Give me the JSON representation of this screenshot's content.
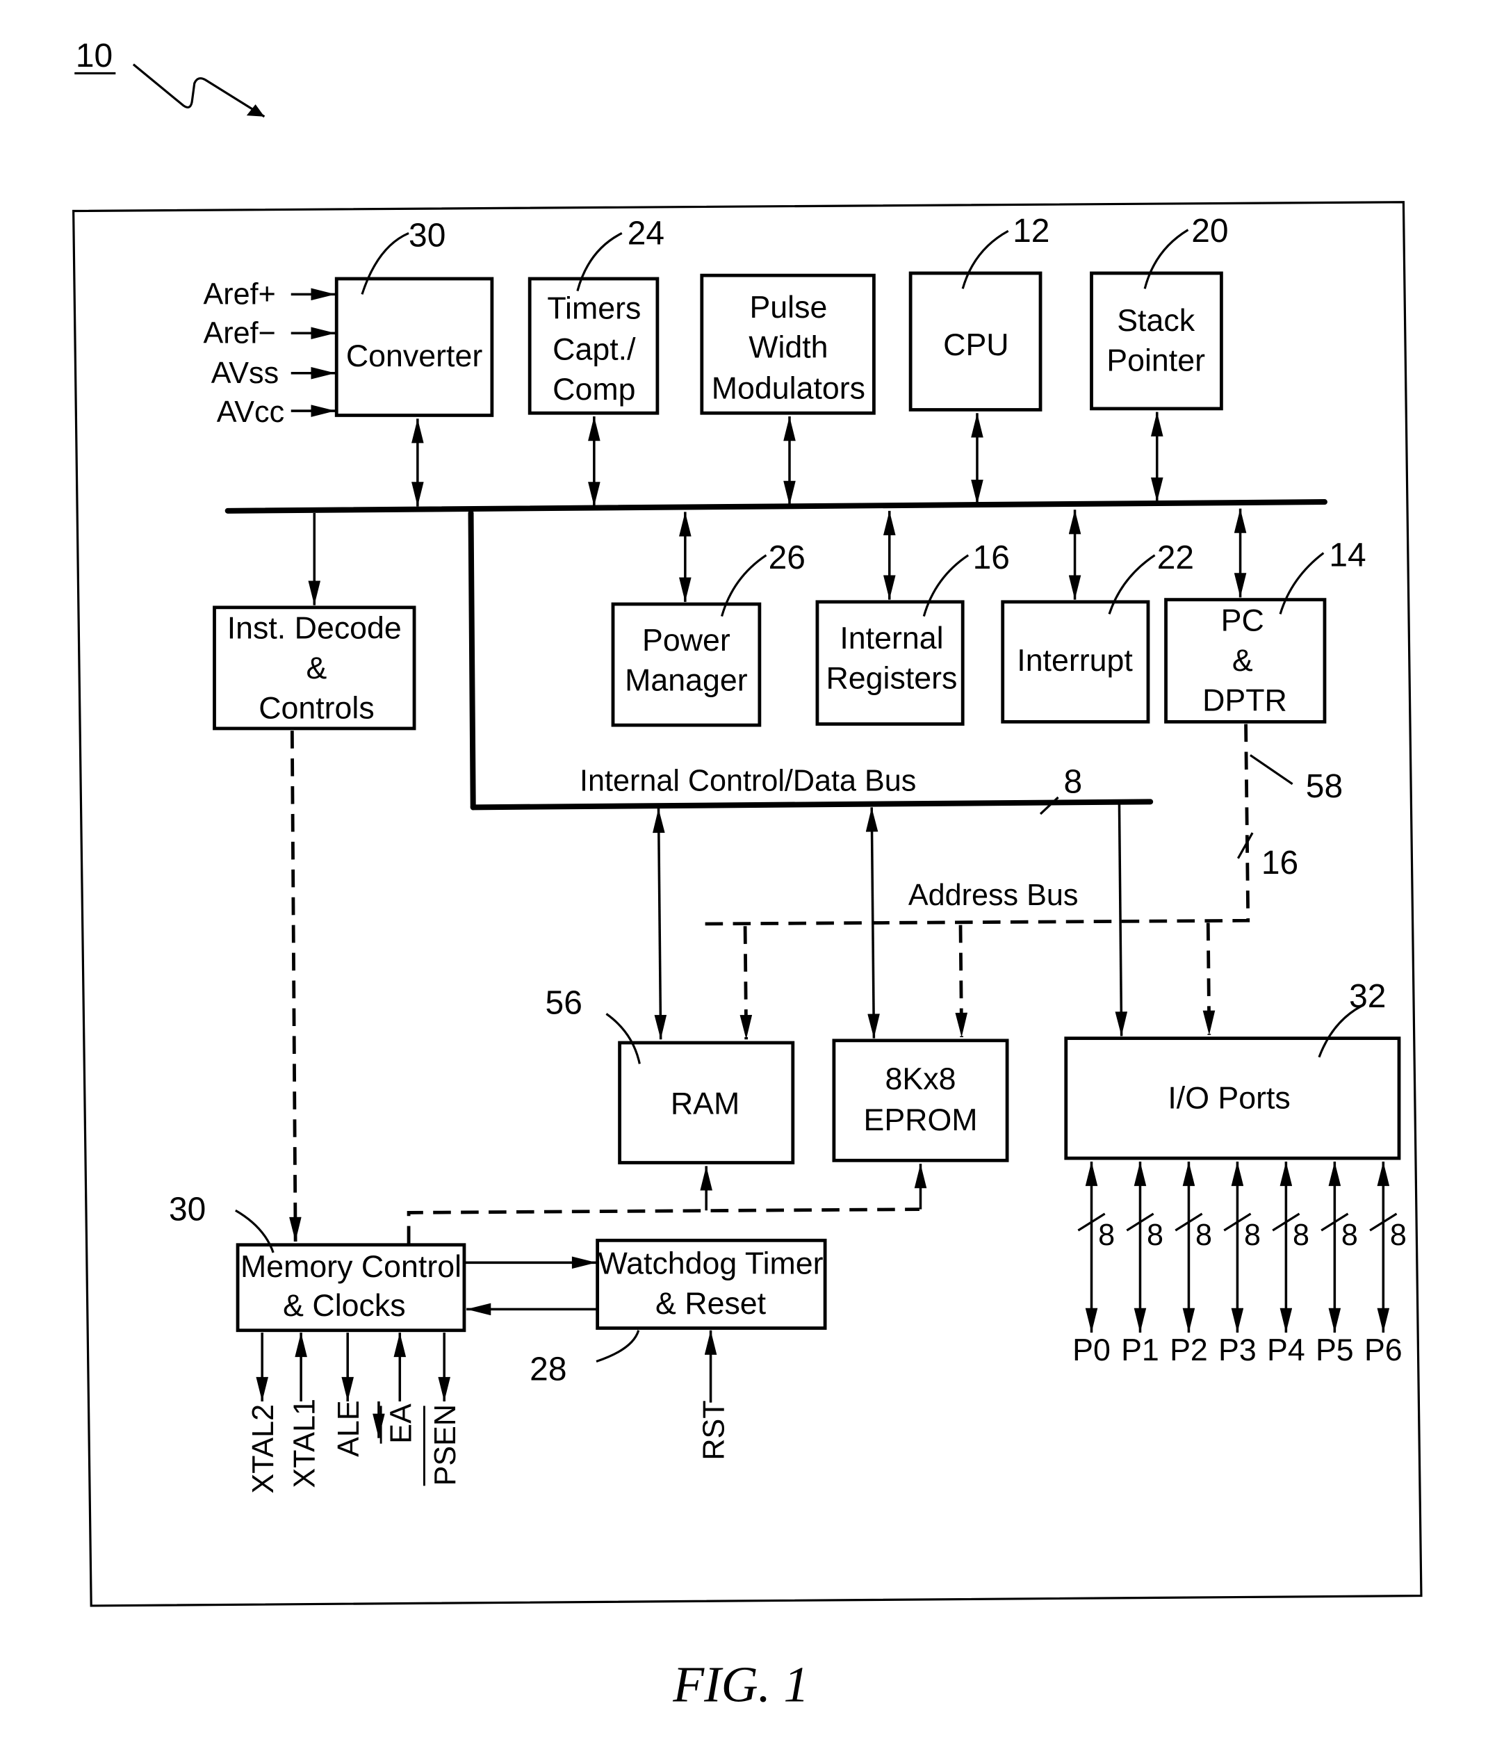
{
  "figure": {
    "ref": "10",
    "caption": "FIG.  1"
  },
  "blocks": {
    "converter": {
      "ref": "30",
      "label": "Converter"
    },
    "timers": {
      "ref": "24",
      "lines": [
        "Timers",
        "Capt./",
        "Comp"
      ]
    },
    "pwm": {
      "lines": [
        "Pulse",
        "Width",
        "Modulators"
      ]
    },
    "cpu": {
      "ref": "12",
      "label": "CPU"
    },
    "stack": {
      "ref": "20",
      "lines": [
        "Stack",
        "Pointer"
      ]
    },
    "inst_decode": {
      "lines": [
        "Inst.  Decode",
        "&",
        "Controls"
      ]
    },
    "power": {
      "ref": "26",
      "lines": [
        "Power",
        "Manager"
      ]
    },
    "internal_regs": {
      "ref": "16",
      "lines": [
        "Internal",
        "Registers"
      ]
    },
    "interrupt": {
      "ref": "22",
      "label": "Interrupt"
    },
    "pc_dptr": {
      "ref": "14",
      "lines": [
        "PC",
        "&",
        "DPTR"
      ]
    },
    "ram": {
      "ref": "56",
      "label": "RAM"
    },
    "eprom": {
      "lines": [
        "8Kx8",
        "EPROM"
      ]
    },
    "io_ports": {
      "ref": "32",
      "label": "I/O  Ports"
    },
    "memory_control": {
      "ref": "30",
      "lines": [
        "Memory  Control",
        "&  Clocks"
      ]
    },
    "watchdog": {
      "ref": "28",
      "lines": [
        "Watchdog  Timer",
        "&  Reset"
      ]
    }
  },
  "converter_inputs": [
    "Aref+",
    "Aref−",
    "AVss",
    "AVcc"
  ],
  "buses": {
    "internal": {
      "label": "Internal  Control/Data  Bus",
      "ref": "8"
    },
    "address": {
      "label": "Address  Bus",
      "ref": "58",
      "width": "16"
    }
  },
  "io_ports": {
    "width": "8",
    "ports": [
      "P0",
      "P1",
      "P2",
      "P3",
      "P4",
      "P5",
      "P6"
    ]
  },
  "memory_control_pins": [
    "XTAL2",
    "XTAL1",
    "ALE",
    "EA",
    "PSEN"
  ],
  "watchdog_pin": "RST"
}
